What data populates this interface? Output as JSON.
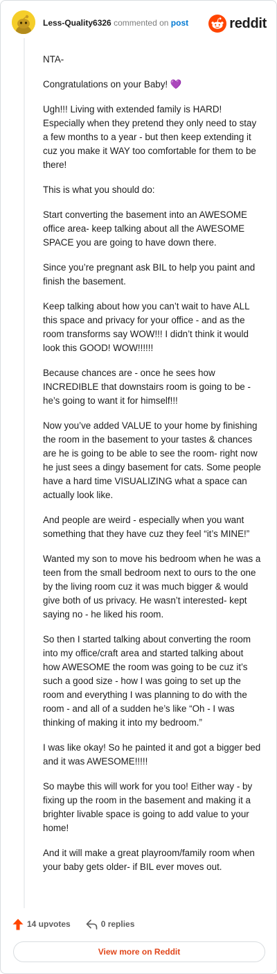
{
  "header": {
    "author": "Less-Quality6326",
    "action_text": "commented on",
    "post_link": "post",
    "brand_name": "reddit"
  },
  "comment": {
    "paragraphs": [
      "NTA-",
      "Congratulations on your Baby! 💜",
      "Ugh!!! Living with extended family is HARD! Especially when they pretend they only need to stay a few months to a year - but then keep extending it cuz you make it WAY too comfortable for them to be there!",
      "This is what you should do:",
      "Start converting the basement into an AWESOME office area- keep talking about all the AWESOME SPACE you are going to have down there.",
      "Since you’re pregnant ask BIL to help you paint and finish the basement.",
      "Keep talking about how you can’t wait to have ALL this space and privacy for your office - and as the room transforms say WOW!!! I didn’t think it would look this GOOD! WOW!!!!!!",
      "Because chances are - once he sees how INCREDIBLE that downstairs room is going to be - he’s going to want it for himself!!!",
      "Now you’ve added VALUE to your home by finishing the room in the basement to your tastes & chances are he is going to be able to see the room- right now he just sees a dingy basement for cats. Some people have a hard time VISUALIZING what a space can actually look like.",
      "And people are weird - especially when you want something that they have cuz they feel “it’s MINE!”",
      "Wanted my son to move his bedroom when he was a teen from the small bedroom next to ours to the one by the living room cuz it was much bigger & would give both of us privacy. He wasn’t interested- kept saying no - he liked his room.",
      "So then I started talking about converting the room into my office/craft area and started talking about how AWESOME the room was going to be cuz it’s such a good size - how I was going to set up the room and everything I was planning to do with the room - and all of a sudden he’s like “Oh - I was thinking of making it into my bedroom.”",
      "I was like okay! So he painted it and got a bigger bed and it was AWESOME!!!!!",
      "So maybe this will work for you too! Either way - by fixing up the room in the basement and making it a brighter livable space is going to add value to your home!",
      "And it will make a great playroom/family room when your baby gets older- if BIL ever moves out."
    ]
  },
  "footer": {
    "upvotes": "14 upvotes",
    "replies": "0 replies",
    "view_more": "View more on Reddit"
  },
  "colors": {
    "upvote": "#ff4500",
    "brand": "#ff4500",
    "link": "#0079d3",
    "view_more": "#e0461a",
    "avatar_bg": "#f5ce2a"
  },
  "icons": [
    "avatar",
    "reddit-logo-icon",
    "upvote-arrow-icon",
    "reply-icon"
  ]
}
